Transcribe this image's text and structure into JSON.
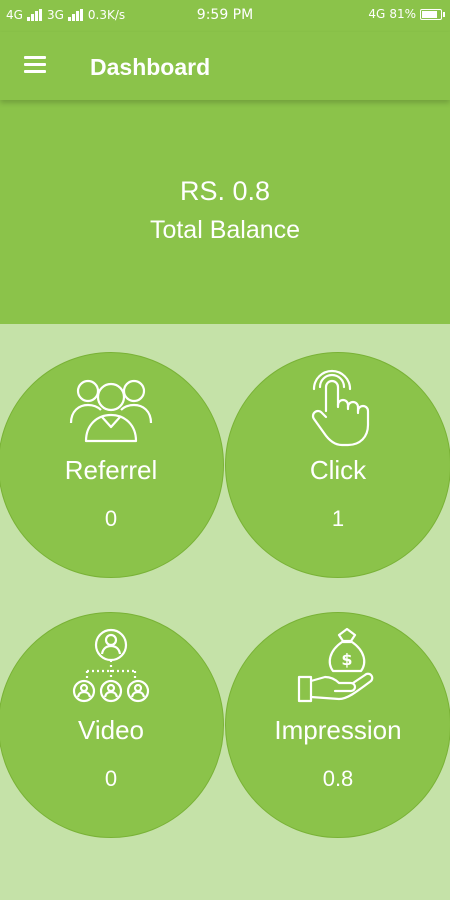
{
  "status_bar": {
    "network_left": "4G",
    "network_right": "3G",
    "speed": "0.3K/s",
    "time": "9:59 PM",
    "network_badge": "4G",
    "battery": "81%"
  },
  "app_bar": {
    "title": "Dashboard",
    "menu_icon": "hamburger-menu-icon"
  },
  "balance": {
    "amount": "RS. 0.8",
    "label": "Total Balance"
  },
  "tiles": [
    {
      "label": "Referrel",
      "value": "0",
      "icon": "users-group-icon"
    },
    {
      "label": "Click",
      "value": "1",
      "icon": "hand-tap-icon"
    },
    {
      "label": "Video",
      "value": "0",
      "icon": "user-network-icon"
    },
    {
      "label": "Impression",
      "value": "0.8",
      "icon": "money-bag-hand-icon"
    }
  ],
  "colors": {
    "primary": "#8bc34a",
    "background": "#c5e2a8",
    "text": "#ffffff"
  }
}
